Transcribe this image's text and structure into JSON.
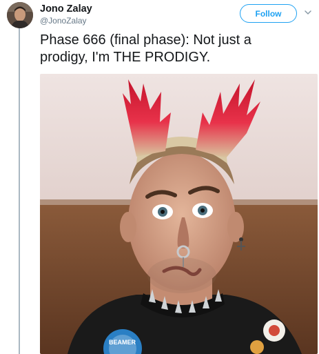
{
  "author": {
    "display_name": "Jono Zalay",
    "handle": "@JonoZalay"
  },
  "actions": {
    "follow_label": "Follow",
    "more_icon": "chevron-down-icon"
  },
  "tweet": {
    "text": "Phase 666 (final phase): Not just a prodigy, I'm THE PRODIGY."
  },
  "media": {
    "badge_text": "BEAMER"
  },
  "colors": {
    "accent": "#1da1f2",
    "text": "#14171a",
    "muted": "#657786",
    "thread_rule": "#aab8c2",
    "hair_red": "#e8324a"
  }
}
